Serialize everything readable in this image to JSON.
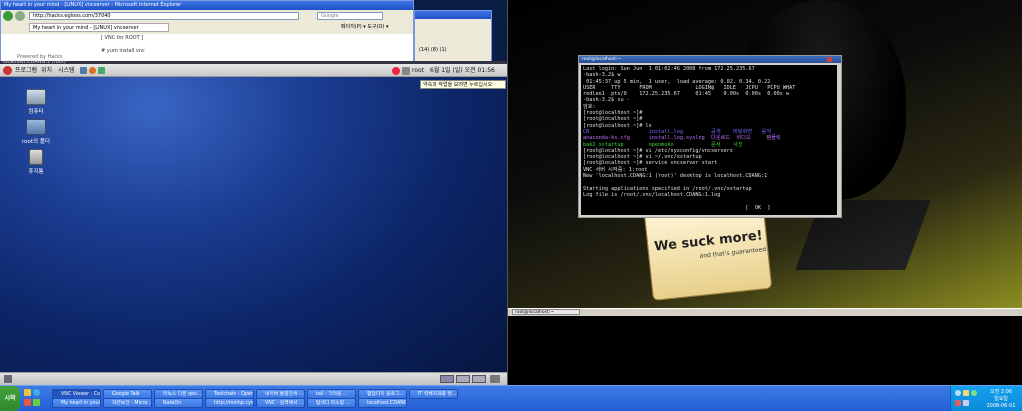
{
  "ie": {
    "title": "My heart in your mind - [LINUX] vncserver - Microsoft Internet Explorer",
    "address": "http://hacks.egloos.com/37040",
    "search_placeholder": "Google",
    "tab_label": "My heart in your mind - [LINUX] vncserver",
    "content_heading": "[ VNC for ROOT ]",
    "content_line": "# yum install vnc",
    "side_note": "Powered by Hacks",
    "toolbar_right": "페이지(P) ▾  도구(O) ▾"
  },
  "ie2": {
    "counts": "(14)  (8)  (1)"
  },
  "gnome": {
    "vnc_title": "localhost.CDANG:1 (root)",
    "menus": [
      "프로그램",
      "위치",
      "시스템"
    ],
    "user": "root",
    "datetime": "6월  1일 (일) 오전 01:56",
    "tooltip": "약속과 작업을 보려면 누르십시오"
  },
  "desktop_icons": [
    {
      "label": "컴퓨터",
      "icon": "computer-icon"
    },
    {
      "label": "root의 폴더",
      "icon": "home-folder-icon"
    },
    {
      "label": "휴지통",
      "icon": "trash-icon"
    }
  ],
  "gnome_bottom_label": "root@localhost:~",
  "terminal": {
    "title": "root@localhost:~",
    "lines": [
      {
        "t": "Last login: Sun Jun  1 01:02:46 2008 from 172.25.235.67"
      },
      {
        "t": "-bash-3.2$ w"
      },
      {
        "t": " 01:45:37 up 5 min,  1 user,  load average: 0.02, 0.34, 0.22"
      },
      {
        "t": "USER     TTY      FROM              LOGIN@   IDLE   JCPU   PCPU WHAT"
      },
      {
        "t": "redleo1  pts/0    172.25.235.67     01:45    0.00s  0.00s  0.00s w"
      },
      {
        "t": "-bash-3.2$ su -"
      },
      {
        "t": "암호:"
      },
      {
        "t": "[root@localhost ~]#"
      },
      {
        "t": "[root@localhost ~]#"
      },
      {
        "t": "[root@localhost ~]# ls"
      },
      {
        "t": "CB                   install.log         공개    바탕화면   음악",
        "c": "mix1"
      },
      {
        "t": "anaconda-ks.cfg      install.log.syslog  다운로드  비디오     템플릿",
        "c": "mix2"
      },
      {
        "t": "bak2_xstartup        openmoko            문서    사진",
        "c": "mix3"
      },
      {
        "t": "[root@localhost ~]# vi /etc/sysconfig/vncservers"
      },
      {
        "t": "[root@localhost ~]# vi ~/.vnc/xstartup"
      },
      {
        "t": "[root@localhost ~]# service vncserver start"
      },
      {
        "t": "VNC 서버 시작중: 1:root"
      },
      {
        "t": "New 'localhost.CDANG:1 (root)' desktop is localhost.CDANG:1"
      },
      {
        "t": ""
      },
      {
        "t": "Starting applications specified in /root/.vnc/xstartup"
      },
      {
        "t": "Log file is /root/.vnc/localhost.CDANG:1.log"
      },
      {
        "t": ""
      },
      {
        "t": "                                                    [  OK  ]"
      },
      {
        "t": ""
      },
      {
        "t": "[root@localhost ~]# "
      }
    ]
  },
  "right_task": "root@localhost:~",
  "banner": {
    "main": "We suck more!",
    "sub": "and that's guaranteed"
  },
  "taskbar": {
    "start": "시작",
    "row1": [
      "VNC Viewer : Conn...",
      "Google Talk",
      "리눅스 다운 qes...",
      "Toolchain - Openm...",
      "네이버 통합검색 -...",
      "tail - 기억을 ...",
      "펌업다지 블로그...",
      "IT 력체자과중 명..."
    ],
    "row2": [
      "My heart in your m...",
      "자연보건 - Micro...",
      "NateOn",
      "http://minhp.cyw...",
      "VNC : 원격에서 ...",
      "탐색디 피소링 ...",
      "localhost.CDANG..."
    ],
    "clock_time": "오전 2:06",
    "clock_day": "일요일",
    "clock_date": "2008-06-01"
  }
}
